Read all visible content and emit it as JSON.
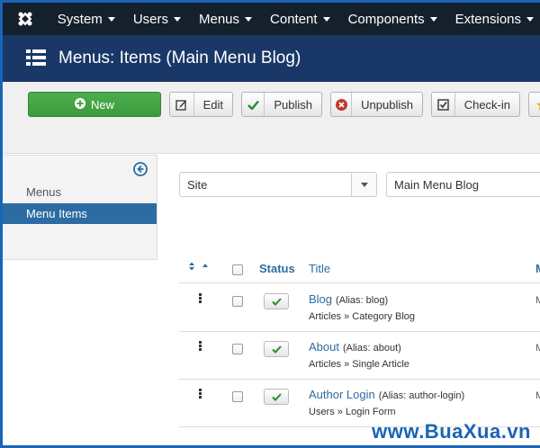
{
  "topnav": {
    "items": [
      {
        "label": "System"
      },
      {
        "label": "Users"
      },
      {
        "label": "Menus"
      },
      {
        "label": "Content"
      },
      {
        "label": "Components"
      },
      {
        "label": "Extensions"
      }
    ]
  },
  "header": {
    "title": "Menus: Items (Main Menu Blog)"
  },
  "toolbar": {
    "new_label": "New",
    "edit_label": "Edit",
    "publish_label": "Publish",
    "unpublish_label": "Unpublish",
    "checkin_label": "Check-in"
  },
  "sidebar": {
    "items": [
      {
        "label": "Menus",
        "active": false
      },
      {
        "label": "Menu Items",
        "active": true
      }
    ]
  },
  "filters": {
    "client": "Site",
    "menu": "Main Menu Blog"
  },
  "table": {
    "headers": {
      "status": "Status",
      "title": "Title",
      "next": "M"
    },
    "rows": [
      {
        "title": "Blog",
        "alias": "(Alias: blog)",
        "type": "Articles » Category Blog",
        "cut": "M"
      },
      {
        "title": "About",
        "alias": "(Alias: about)",
        "type": "Articles » Single Article",
        "cut": "M"
      },
      {
        "title": "Author Login",
        "alias": "(Alias: author-login)",
        "type": "Users » Login Form",
        "cut": "M"
      }
    ]
  },
  "watermark": "www.BuaXua.vn",
  "colors": {
    "topnav_bg": "#15202d",
    "header_bg": "#1a3867",
    "new_button": "#46a546",
    "link": "#2d6ca2",
    "active_sidebar": "#2d6ca2"
  }
}
